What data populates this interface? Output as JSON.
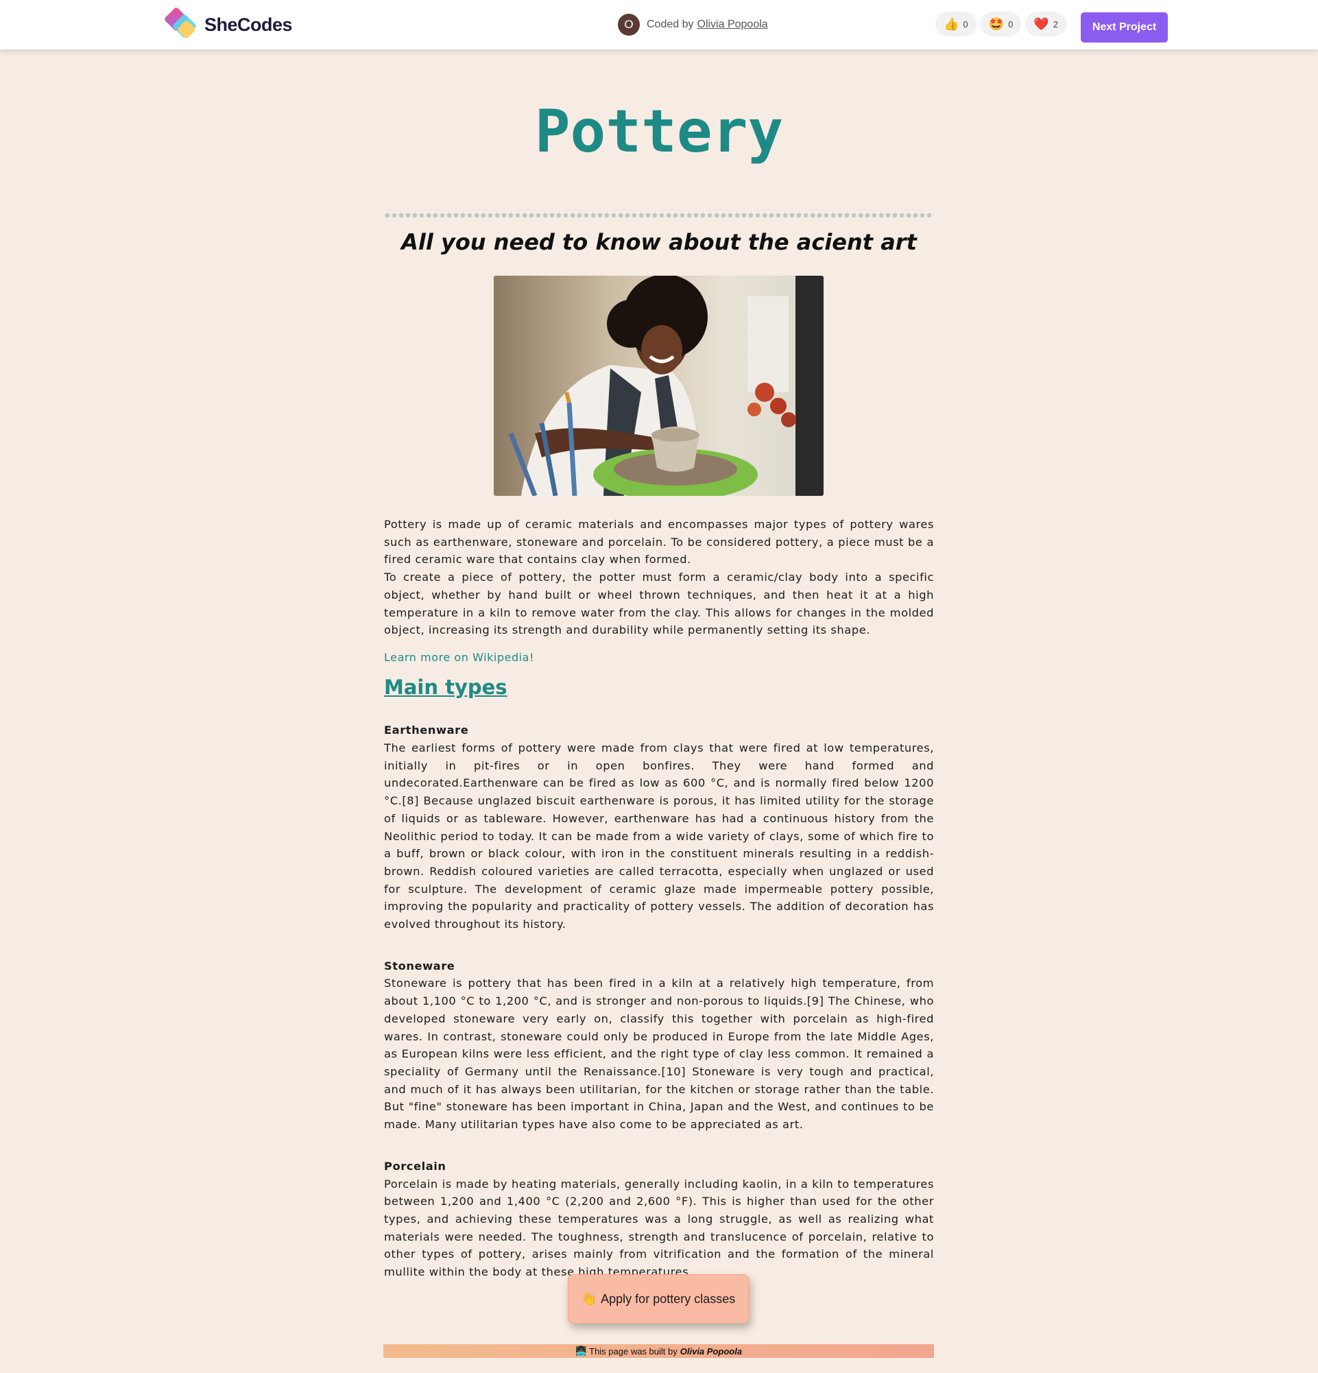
{
  "header": {
    "logo_text": "SheCodes",
    "avatar_letter": "O",
    "coded_by_prefix": "Coded by",
    "author_name": "Olivia Popoola",
    "reactions": [
      {
        "icon": "thumbs-up",
        "glyph": "👍",
        "count": "0"
      },
      {
        "icon": "star-struck",
        "glyph": "🤩",
        "count": "0"
      },
      {
        "icon": "heart",
        "glyph": "❤️",
        "count": "2"
      }
    ],
    "next_label": "Next Project",
    "accent": "#8c5cf0"
  },
  "page": {
    "title": "Pottery",
    "subtitle": "All you need to know about the acient art",
    "title_color": "#1e8a86",
    "background": "#f6ece3"
  },
  "intro": {
    "p1": "Pottery is made up of ceramic materials and encompasses major types of pottery wares such as earthenware, stoneware and porcelain. To be considered pottery, a piece must be a fired ceramic ware that contains clay when formed.",
    "p2": "To create a piece of pottery, the potter must form a ceramic/clay body into a specific object, whether by hand built or wheel thrown techniques, and then heat it at a high temperature in a kiln to remove water from the clay. This allows for changes in the molded object, increasing its strength and durability while permanently setting its shape.",
    "wiki_link": "Learn more on Wikipedia!"
  },
  "types": {
    "heading": "Main types",
    "items": [
      {
        "name": "Earthenware",
        "text": "The earliest forms of pottery were made from clays that were fired at low temperatures, initially in pit-fires or in open bonfires. They were hand formed and undecorated.Earthenware can be fired as low as 600 °C, and is normally fired below 1200 °C.[8] Because unglazed biscuit earthenware is porous, it has limited utility for the storage of liquids or as tableware. However, earthenware has had a continuous history from the Neolithic period to today. It can be made from a wide variety of clays, some of which fire to a buff, brown or black colour, with iron in the constituent minerals resulting in a reddish-brown. Reddish coloured varieties are called terracotta, especially when unglazed or used for sculpture. The development of ceramic glaze made impermeable pottery possible, improving the popularity and practicality of pottery vessels. The addition of decoration has evolved throughout its history."
      },
      {
        "name": "Stoneware",
        "text": "Stoneware is pottery that has been fired in a kiln at a relatively high temperature, from about 1,100 °C to 1,200 °C, and is stronger and non-porous to liquids.[9] The Chinese, who developed stoneware very early on, classify this together with porcelain as high-fired wares. In contrast, stoneware could only be produced in Europe from the late Middle Ages, as European kilns were less efficient, and the right type of clay less common. It remained a speciality of Germany until the Renaissance.[10] Stoneware is very tough and practical, and much of it has always been utilitarian, for the kitchen or storage rather than the table. But \"fine\" stoneware has been important in China, Japan and the West, and continues to be made. Many utilitarian types have also come to be appreciated as art."
      },
      {
        "name": "Porcelain",
        "text": "Porcelain is made by heating materials, generally including kaolin, in a kiln to temperatures between 1,200 and 1,400 °C (2,200 and 2,600 °F). This is higher than used for the other types, and achieving these temperatures was a long struggle, as well as realizing what materials were needed. The toughness, strength and translucence of porcelain, relative to other types of pottery, arises mainly from vitrification and the formation of the mineral mullite within the body at these high temperatures."
      }
    ]
  },
  "cta": {
    "glyph": "👋",
    "label": "Apply for pottery classes",
    "color": "#f9bba3"
  },
  "footer": {
    "glyph": "👩🏿‍💻",
    "prefix": "This page was built by",
    "author": "Olivia Popoola"
  }
}
